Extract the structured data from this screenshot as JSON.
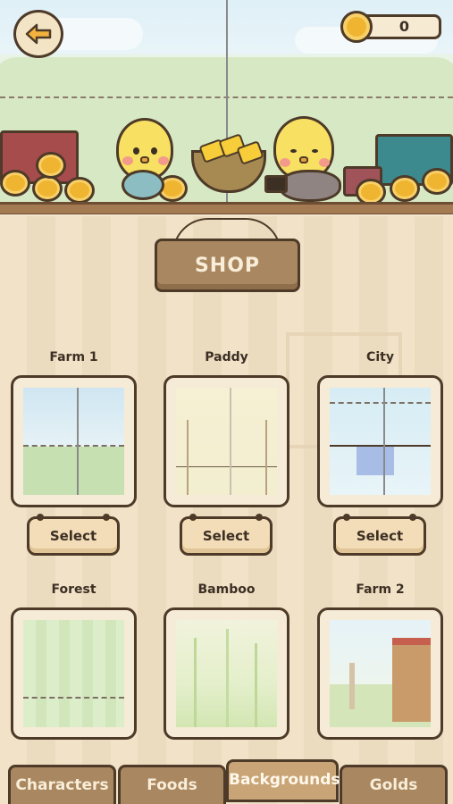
{
  "top_bar": {
    "back_icon": "back-arrow-icon",
    "coin_icon": "coin-icon",
    "coins": "0"
  },
  "shop": {
    "sign_label": "SHOP"
  },
  "backgrounds": [
    {
      "title": "Farm 1",
      "select_label": "Select",
      "has_select": true
    },
    {
      "title": "Paddy",
      "select_label": "Select",
      "has_select": true
    },
    {
      "title": "City",
      "select_label": "Select",
      "has_select": true
    },
    {
      "title": "Forest",
      "has_select": false
    },
    {
      "title": "Bamboo",
      "has_select": false
    },
    {
      "title": "Farm 2",
      "has_select": false
    }
  ],
  "tabs": [
    {
      "label": "Characters",
      "active": false
    },
    {
      "label": "Foods",
      "active": false
    },
    {
      "label": "Backgrounds",
      "active": true
    },
    {
      "label": "Golds",
      "active": false
    }
  ],
  "colors": {
    "outline": "#4d3a28",
    "wood": "#a98760",
    "coin": "#f0b530",
    "panel": "#f1e2c8"
  }
}
